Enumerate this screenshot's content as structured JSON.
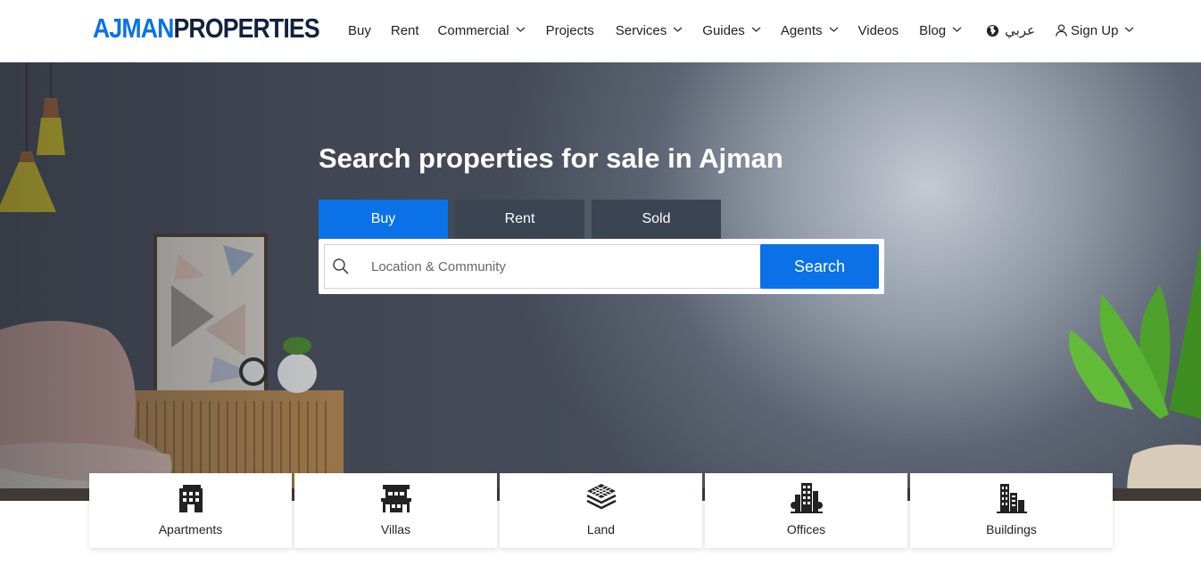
{
  "header": {
    "logo": {
      "part1": "AJMAN",
      "part2": "PROPERTIES"
    },
    "nav": [
      {
        "label": "Buy",
        "dropdown": false
      },
      {
        "label": "Rent",
        "dropdown": false
      },
      {
        "label": "Commercial",
        "dropdown": true
      },
      {
        "label": "Projects",
        "dropdown": false
      },
      {
        "label": "Services",
        "dropdown": true
      },
      {
        "label": "Guides",
        "dropdown": true
      },
      {
        "label": "Agents",
        "dropdown": true
      },
      {
        "label": "Videos",
        "dropdown": false
      },
      {
        "label": "Blog",
        "dropdown": true
      }
    ],
    "language": {
      "label": "عربي",
      "icon": "globe-icon"
    },
    "signup": {
      "label": "Sign Up",
      "icon": "user-icon"
    }
  },
  "hero": {
    "title": "Search properties for sale in Ajman",
    "tabs": [
      {
        "label": "Buy",
        "active": true
      },
      {
        "label": "Rent",
        "active": false
      },
      {
        "label": "Sold",
        "active": false
      }
    ],
    "search": {
      "placeholder": "Location & Community",
      "value": "",
      "button": "Search"
    }
  },
  "categories": [
    {
      "label": "Apartments",
      "icon": "apartment-building-icon"
    },
    {
      "label": "Villas",
      "icon": "villa-icon"
    },
    {
      "label": "Land",
      "icon": "land-layers-icon"
    },
    {
      "label": "Offices",
      "icon": "office-tower-icon"
    },
    {
      "label": "Buildings",
      "icon": "buildings-icon"
    }
  ],
  "colors": {
    "accent": "#0a72e6",
    "logo_dark": "#12223d",
    "tab_inactive": "#3a4452"
  }
}
